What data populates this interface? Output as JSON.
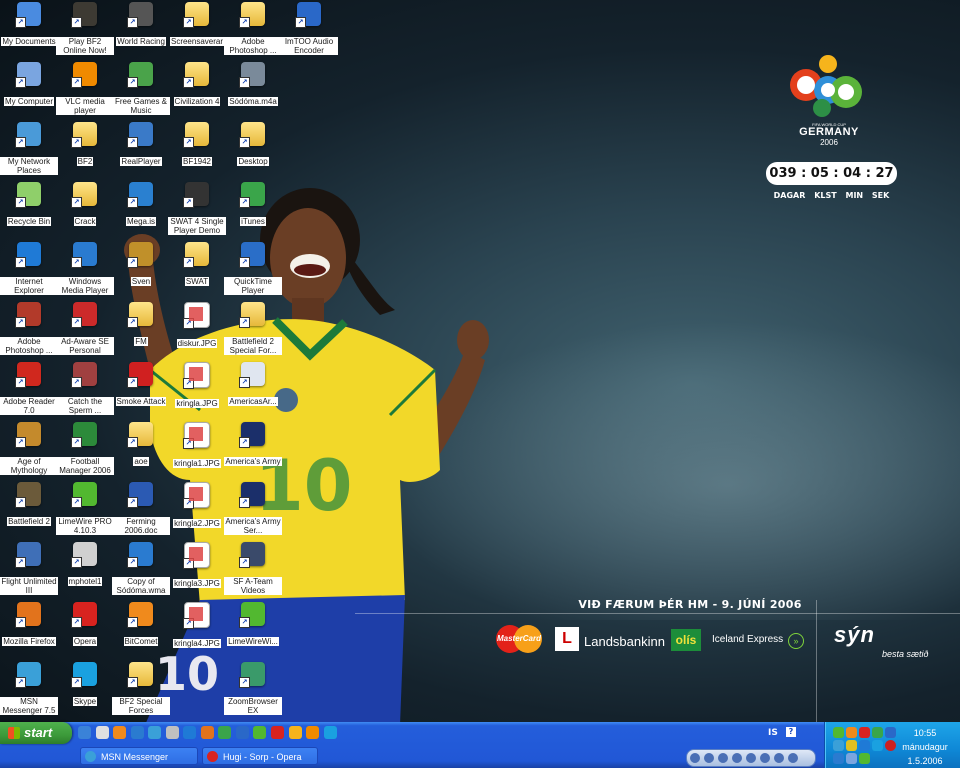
{
  "desktop_icons": [
    {
      "label": "My Documents",
      "icon": "my-documents-icon",
      "color": "#4a8be0"
    },
    {
      "label": "My Computer",
      "icon": "my-computer-icon",
      "color": "#7aa5e0"
    },
    {
      "label": "My Network Places",
      "icon": "network-icon",
      "color": "#4a9ad8"
    },
    {
      "label": "Recycle Bin",
      "icon": "recycle-bin-icon",
      "color": "#8fcf6a"
    },
    {
      "label": "Internet Explorer",
      "icon": "ie-icon",
      "color": "#1f7ad6"
    },
    {
      "label": "Adobe Photoshop ...",
      "icon": "photoshop-icon",
      "color": "#b23a2a"
    },
    {
      "label": "Adobe Reader 7.0",
      "icon": "adobe-reader-icon",
      "color": "#d0281e"
    },
    {
      "label": "Age of Mythology",
      "icon": "age-of-mythology-icon",
      "color": "#c48a2c"
    },
    {
      "label": "Battlefield 2",
      "icon": "battlefield-icon",
      "color": "#6b5a3a"
    },
    {
      "label": "Flight Unlimited III",
      "icon": "flight-icon",
      "color": "#3f6fb7"
    },
    {
      "label": "Mozilla Firefox",
      "icon": "firefox-icon",
      "color": "#e2731c"
    },
    {
      "label": "MSN Messenger 7.5",
      "icon": "msn-icon",
      "color": "#3aa0d8"
    },
    {
      "label": "Play BF2 Online Now!",
      "icon": "bf2-online-icon",
      "color": "#3d3a33"
    },
    {
      "label": "VLC media player",
      "icon": "vlc-icon",
      "color": "#f08a00"
    },
    {
      "label": "BF2",
      "icon": "folder-icon",
      "color": "#f2cf55"
    },
    {
      "label": "Crack",
      "icon": "folder-icon",
      "color": "#f2cf55"
    },
    {
      "label": "Windows Media Player",
      "icon": "wmp-icon",
      "color": "#2a7bd0"
    },
    {
      "label": "Ad-Aware SE Personal",
      "icon": "adaware-icon",
      "color": "#cc2a2a"
    },
    {
      "label": "Catch the Sperm ...",
      "icon": "game-icon",
      "color": "#a04040"
    },
    {
      "label": "Football Manager 2006",
      "icon": "football-manager-icon",
      "color": "#2c8a3a"
    },
    {
      "label": "LimeWire PRO 4.10.3",
      "icon": "limewire-icon",
      "color": "#52b830"
    },
    {
      "label": "mphotel1",
      "icon": "file-icon",
      "color": "#d0d0d0"
    },
    {
      "label": "Opera",
      "icon": "opera-icon",
      "color": "#d8231f"
    },
    {
      "label": "Skype",
      "icon": "skype-icon",
      "color": "#1aa1e0"
    },
    {
      "label": "World Racing",
      "icon": "world-racing-icon",
      "color": "#555555"
    },
    {
      "label": "Free Games & Music",
      "icon": "gift-icon",
      "color": "#4aa34a"
    },
    {
      "label": "RealPlayer",
      "icon": "realplayer-icon",
      "color": "#3a7ac8"
    },
    {
      "label": "Mega.is",
      "icon": "ie-page-icon",
      "color": "#2a80d0"
    },
    {
      "label": "Sven",
      "icon": "sven-icon",
      "color": "#c0902a"
    },
    {
      "label": "FM",
      "icon": "folder-icon",
      "color": "#f2cf55"
    },
    {
      "label": "Smoke Attack",
      "icon": "no-smoking-icon",
      "color": "#d02020"
    },
    {
      "label": "aoe",
      "icon": "folder-icon",
      "color": "#f2cf55"
    },
    {
      "label": "Ferming 2006.doc",
      "icon": "word-doc-icon",
      "color": "#2b5ab3"
    },
    {
      "label": "Copy of Sódóma.wma",
      "icon": "wma-icon",
      "color": "#2a7bd0"
    },
    {
      "label": "BitComet",
      "icon": "bitcomet-icon",
      "color": "#f08a1c"
    },
    {
      "label": "BF2 Special Forces",
      "icon": "folder-icon",
      "color": "#f2cf55"
    },
    {
      "label": "Screensaverar",
      "icon": "folder-icon",
      "color": "#f2cf55"
    },
    {
      "label": "Civilization 4",
      "icon": "folder-icon",
      "color": "#f2cf55"
    },
    {
      "label": "BF1942",
      "icon": "folder-icon",
      "color": "#f2cf55"
    },
    {
      "label": "SWAT 4 Single Player Demo",
      "icon": "swat-icon",
      "color": "#333333"
    },
    {
      "label": "SWAT",
      "icon": "folder-icon",
      "color": "#f2cf55"
    },
    {
      "label": "diskur.JPG",
      "icon": "jpg-icon",
      "color": "#ffffff"
    },
    {
      "label": "kringla.JPG",
      "icon": "jpg-icon",
      "color": "#ffffff"
    },
    {
      "label": "kringla1.JPG",
      "icon": "jpg-icon",
      "color": "#ffffff"
    },
    {
      "label": "kringla2.JPG",
      "icon": "jpg-icon",
      "color": "#ffffff"
    },
    {
      "label": "kringla3.JPG",
      "icon": "jpg-icon",
      "color": "#ffffff"
    },
    {
      "label": "kringla4.JPG",
      "icon": "jpg-icon",
      "color": "#ffffff"
    },
    {
      "label": "Adobe Photoshop ...",
      "icon": "folder-icon",
      "color": "#f2cf55"
    },
    {
      "label": "Sódóma.m4a",
      "icon": "m4a-icon",
      "color": "#7a8a9a"
    },
    {
      "label": "Desktop",
      "icon": "folder-icon",
      "color": "#f2cf55"
    },
    {
      "label": "iTunes",
      "icon": "itunes-icon",
      "color": "#3aa54a"
    },
    {
      "label": "QuickTime Player",
      "icon": "quicktime-icon",
      "color": "#2a6ec8"
    },
    {
      "label": "Battlefield 2 Special For...",
      "icon": "folder-icon",
      "color": "#f2cf55"
    },
    {
      "label": "AmericasAr...",
      "icon": "window-icon",
      "color": "#e0e6f0"
    },
    {
      "label": "America's Army",
      "icon": "americas-army-icon",
      "color": "#1b2f6a"
    },
    {
      "label": "America's Army Ser...",
      "icon": "americas-army-icon",
      "color": "#1b2f6a"
    },
    {
      "label": "SF A-Team Videos",
      "icon": "video-icon",
      "color": "#3a4a6a"
    },
    {
      "label": "LimeWireWi...",
      "icon": "limewire-icon",
      "color": "#52b830"
    },
    {
      "label": "ZoomBrowser EX",
      "icon": "zoombrowser-icon",
      "color": "#3a9a6a"
    },
    {
      "label": "ImTOO Audio Encoder",
      "icon": "imtoo-icon",
      "color": "#2a68c8"
    },
    {
      "label": "Sódóma.wma",
      "icon": "wma-icon",
      "color": "#2a7bd0"
    }
  ],
  "widget": {
    "countdown": "039 : 05 : 04 : 27",
    "units": "DAGAR KLST MIN SEK",
    "logo_line1": "FIFA WORLD CUP",
    "logo_line2": "GERMANY",
    "logo_line3": "2006"
  },
  "wallpaper": {
    "slogan": "VIÐ FÆRUM ÞÉR HM - 9. JÚNÍ 2006",
    "jersey_number": "10",
    "sponsors": {
      "mastercard": "MasterCard",
      "landsbankinn": "Landsbankinn",
      "olis": "olís",
      "iceland_express": "Iceland Express",
      "syn": "sýn",
      "syn_tagline": "besta sætið"
    }
  },
  "taskbar": {
    "start_label": "start",
    "buttons": [
      {
        "label": "MSN Messenger",
        "icon": "msn-icon"
      },
      {
        "label": "Hugi - Sorp - Opera",
        "icon": "opera-icon"
      }
    ],
    "language": "IS",
    "clock_time": "10:55",
    "clock_day": "mánudagur",
    "clock_date": "1.5.2006"
  }
}
